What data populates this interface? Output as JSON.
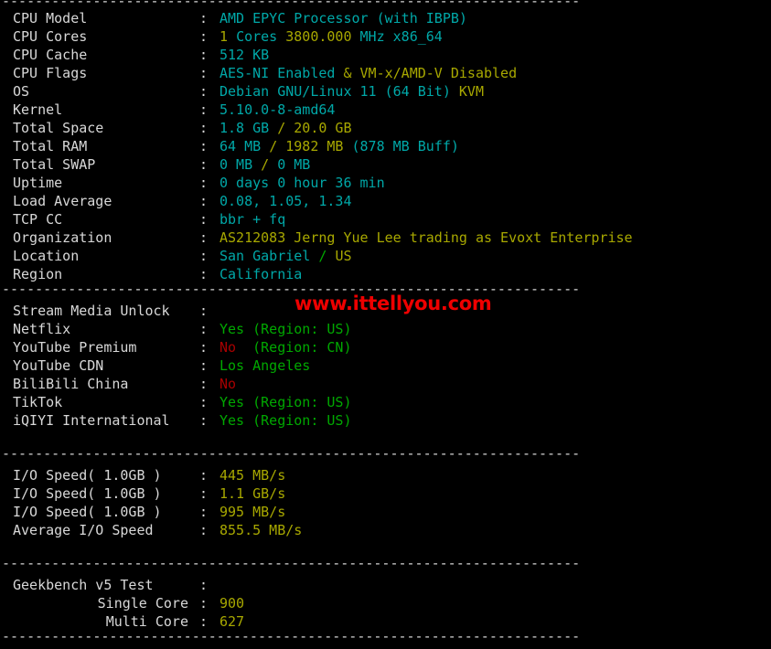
{
  "terminal": {
    "separator": "----------------------------------------------------------------------",
    "watermark": "www.ittellyou.com",
    "colon": ":"
  },
  "sections": {
    "system": {
      "rows": [
        {
          "label": "CPU Model",
          "parts": [
            {
              "t": "AMD EPYC Processor (with IBPB)",
              "c": "cyan"
            }
          ]
        },
        {
          "label": "CPU Cores",
          "parts": [
            {
              "t": "1 ",
              "c": "yellow"
            },
            {
              "t": "Cores ",
              "c": "cyan"
            },
            {
              "t": "3800.000 ",
              "c": "yellow"
            },
            {
              "t": "MHz ",
              "c": "cyan"
            },
            {
              "t": "x86_64",
              "c": "cyan"
            }
          ]
        },
        {
          "label": "CPU Cache",
          "parts": [
            {
              "t": "512 KB",
              "c": "cyan"
            }
          ]
        },
        {
          "label": "CPU Flags",
          "parts": [
            {
              "t": "AES-NI Enabled ",
              "c": "cyan"
            },
            {
              "t": "& ",
              "c": "yellow"
            },
            {
              "t": "VM-x/AMD-V ",
              "c": "yellow"
            },
            {
              "t": "Disabled",
              "c": "yellow"
            }
          ]
        },
        {
          "label": "OS",
          "parts": [
            {
              "t": "Debian GNU/Linux 11 (64 Bit) ",
              "c": "cyan"
            },
            {
              "t": "KVM",
              "c": "yellow"
            }
          ]
        },
        {
          "label": "Kernel",
          "parts": [
            {
              "t": "5.10.0-8-amd64",
              "c": "cyan"
            }
          ]
        },
        {
          "label": "Total Space",
          "parts": [
            {
              "t": "1.8 GB ",
              "c": "cyan"
            },
            {
              "t": "/ ",
              "c": "yellow"
            },
            {
              "t": "20.0 GB",
              "c": "yellow"
            }
          ]
        },
        {
          "label": "Total RAM",
          "parts": [
            {
              "t": "64 MB ",
              "c": "cyan"
            },
            {
              "t": "/ ",
              "c": "yellow"
            },
            {
              "t": "1982 MB ",
              "c": "yellow"
            },
            {
              "t": "(878 MB Buff)",
              "c": "cyan"
            }
          ]
        },
        {
          "label": "Total SWAP",
          "parts": [
            {
              "t": "0 MB ",
              "c": "cyan"
            },
            {
              "t": "/ ",
              "c": "yellow"
            },
            {
              "t": "0 MB",
              "c": "cyan"
            }
          ]
        },
        {
          "label": "Uptime",
          "parts": [
            {
              "t": "0 days 0 hour 36 min",
              "c": "cyan"
            }
          ]
        },
        {
          "label": "Load Average",
          "parts": [
            {
              "t": "0.08, 1.05, 1.34",
              "c": "cyan"
            }
          ]
        },
        {
          "label": "TCP CC",
          "parts": [
            {
              "t": "bbr + fq",
              "c": "cyan"
            }
          ]
        },
        {
          "label": "Organization",
          "parts": [
            {
              "t": "AS212083 Jerng Yue Lee trading as Evoxt Enterprise",
              "c": "yellow"
            }
          ]
        },
        {
          "label": "Location",
          "parts": [
            {
              "t": "San Gabriel ",
              "c": "cyan"
            },
            {
              "t": "/ ",
              "c": "green"
            },
            {
              "t": "US",
              "c": "yellow"
            }
          ]
        },
        {
          "label": "Region",
          "parts": [
            {
              "t": "California",
              "c": "cyan"
            }
          ]
        }
      ]
    },
    "stream": {
      "rows": [
        {
          "label": "Stream Media Unlock",
          "parts": []
        },
        {
          "label": "Netflix",
          "parts": [
            {
              "t": "Yes (Region: US)",
              "c": "green"
            }
          ]
        },
        {
          "label": "YouTube Premium",
          "parts": [
            {
              "t": "No",
              "c": "red"
            },
            {
              "t": "  (Region: CN)",
              "c": "green"
            }
          ]
        },
        {
          "label": "YouTube CDN",
          "parts": [
            {
              "t": "Los Angeles",
              "c": "green"
            }
          ]
        },
        {
          "label": "BiliBili China",
          "parts": [
            {
              "t": "No",
              "c": "red"
            }
          ]
        },
        {
          "label": "TikTok",
          "parts": [
            {
              "t": "Yes (Region: US)",
              "c": "green"
            }
          ]
        },
        {
          "label": "iQIYI International",
          "parts": [
            {
              "t": "Yes (Region: US)",
              "c": "green"
            }
          ]
        }
      ]
    },
    "io": {
      "rows": [
        {
          "label": "I/O Speed( 1.0GB )",
          "parts": [
            {
              "t": "445 MB/s",
              "c": "yellow"
            }
          ]
        },
        {
          "label": "I/O Speed( 1.0GB )",
          "parts": [
            {
              "t": "1.1 GB/s",
              "c": "yellow"
            }
          ]
        },
        {
          "label": "I/O Speed( 1.0GB )",
          "parts": [
            {
              "t": "995 MB/s",
              "c": "yellow"
            }
          ]
        },
        {
          "label": "Average I/O Speed",
          "parts": [
            {
              "t": "855.5 MB/s",
              "c": "yellow"
            }
          ]
        }
      ]
    },
    "geekbench": {
      "rows": [
        {
          "label": "Geekbench v5 Test",
          "align": "left",
          "parts": []
        },
        {
          "label": "Single Core",
          "align": "right",
          "parts": [
            {
              "t": "900",
              "c": "yellow"
            }
          ]
        },
        {
          "label": "Multi Core",
          "align": "right",
          "parts": [
            {
              "t": "627",
              "c": "yellow"
            }
          ]
        }
      ]
    }
  }
}
